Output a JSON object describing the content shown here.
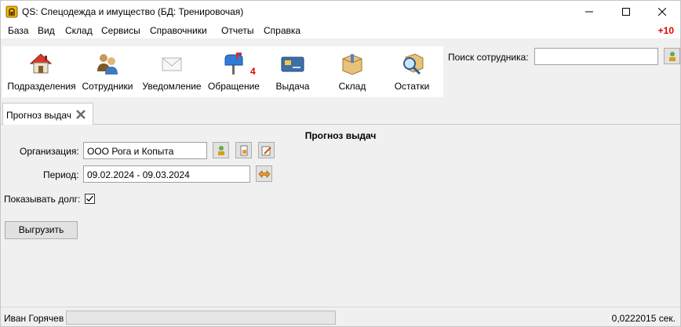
{
  "window": {
    "title": "QS: Спецодежда и имущество (БД: Тренировочая)"
  },
  "menu": {
    "items": [
      "База",
      "Вид",
      "Склад",
      "Сервисы",
      "Справочники",
      "Отчеты",
      "Справка"
    ],
    "notification_count": "+10"
  },
  "toolbar": {
    "items": [
      {
        "label": "Подразделения",
        "icon": "house-icon"
      },
      {
        "label": "Сотрудники",
        "icon": "people-icon"
      },
      {
        "label": "Уведомление",
        "icon": "envelope-icon"
      },
      {
        "label": "Обращение",
        "icon": "mailbox-icon",
        "badge": "4"
      },
      {
        "label": "Выдача",
        "icon": "card-icon"
      },
      {
        "label": "Склад",
        "icon": "box-icon"
      },
      {
        "label": "Остатки",
        "icon": "magnifier-box-icon"
      }
    ]
  },
  "search": {
    "label": "Поиск сотрудника:",
    "value": ""
  },
  "tab": {
    "label": "Прогноз выдач"
  },
  "form": {
    "heading": "Прогноз выдач",
    "organization_label": "Организация:",
    "organization_value": "ООО Рога и Копыта",
    "period_label": "Период:",
    "period_value": "09.02.2024 - 09.03.2024",
    "show_debt_label": "Показывать долг:",
    "show_debt_checked": true,
    "export_button": "Выгрузить"
  },
  "status": {
    "user": "Иван Горячев",
    "elapsed": "0,0222015 сек."
  }
}
